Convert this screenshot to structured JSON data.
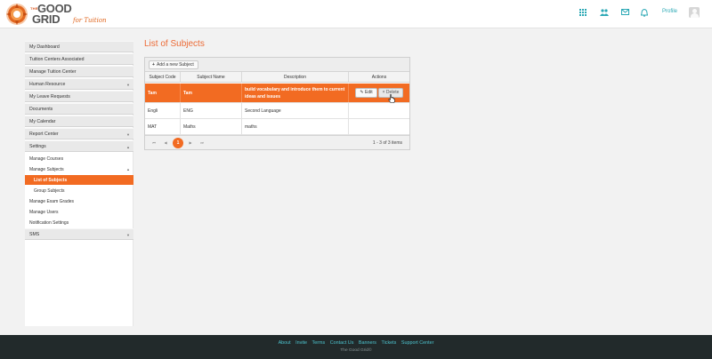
{
  "header": {
    "logo": {
      "the": "THE",
      "good": "GOOD",
      "grid": "GRID",
      "tagline": "for Tuition"
    },
    "nav_icons": [
      "grid-icon",
      "users-icon",
      "mail-icon",
      "bell-icon"
    ],
    "profile_label": "Profile"
  },
  "sidebar": {
    "items": [
      {
        "label": "My Dashboard",
        "caret": ""
      },
      {
        "label": "Tuition Centers Associated",
        "caret": ""
      },
      {
        "label": "Manage Tuition Center",
        "caret": ""
      },
      {
        "label": "Human Resource",
        "caret": "▼"
      },
      {
        "label": "My Leave Requests",
        "caret": ""
      },
      {
        "label": "Documents",
        "caret": ""
      },
      {
        "label": "My Calendar",
        "caret": ""
      },
      {
        "label": "Report Center",
        "caret": "▼"
      },
      {
        "label": "Settings",
        "caret": "▲"
      }
    ],
    "settings_children": [
      {
        "label": "Manage Courses",
        "caret": ""
      },
      {
        "label": "Manage Subjects",
        "caret": "▲"
      },
      {
        "label": "List of Subjects",
        "caret": ""
      },
      {
        "label": "Group Subjects",
        "caret": ""
      },
      {
        "label": "Manage Exam Grades",
        "caret": ""
      },
      {
        "label": "Manage Users",
        "caret": ""
      },
      {
        "label": "Notification Settings",
        "caret": ""
      }
    ],
    "last_item": {
      "label": "SMS",
      "caret": "▼"
    }
  },
  "main": {
    "title": "List of Subjects",
    "add_button": "Add a new Subject",
    "columns": [
      "Subject Code",
      "Subject Name",
      "Description",
      "Actions"
    ],
    "rows": [
      {
        "code": "Tam",
        "name": "Tam",
        "description": "build vocabulary and introduce them to current ideas and issues"
      },
      {
        "code": "Engli",
        "name": "ENG",
        "description": "Second Language"
      },
      {
        "code": "MAT",
        "name": "Maths",
        "description": "maths"
      }
    ],
    "edit_label": "Edit",
    "delete_label": "Delete",
    "pager": {
      "first": "⏮",
      "prev": "◀",
      "current_page": "1",
      "next": "▶",
      "last": "⏭",
      "info": "1 - 3 of 3 items"
    }
  },
  "footer": {
    "links": [
      "About",
      "Invite",
      "Terms",
      "Contact Us",
      "Banners",
      "Tickets",
      "Support Center"
    ],
    "copyright": "The Good Grid©"
  },
  "colors": {
    "accent": "#f26b22",
    "teal": "#2ba8b5",
    "footer_bg": "#222a2b"
  }
}
